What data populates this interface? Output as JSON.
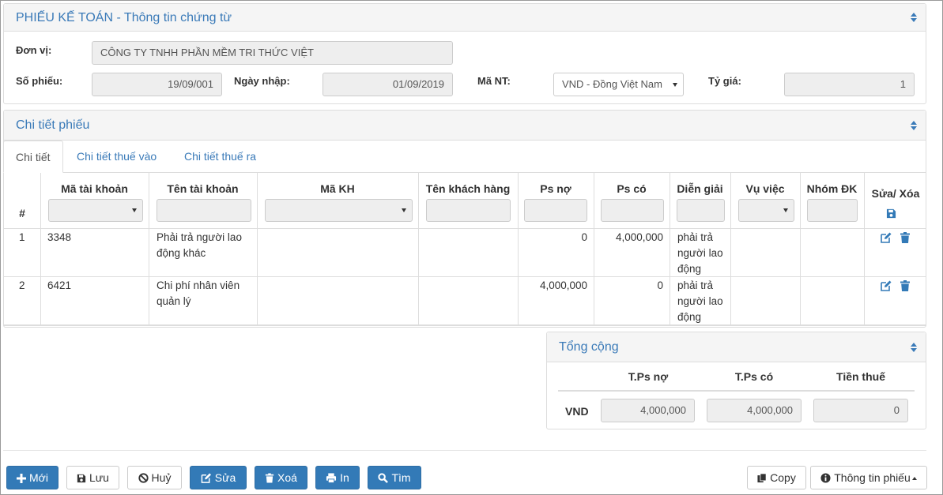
{
  "voucher_panel": {
    "title": "PHIẾU KẾ TOÁN - Thông tin chứng từ",
    "unit_label": "Đơn vị:",
    "unit_value": "CÔNG TY TNHH PHẦN MỀM TRI THỨC VIỆT",
    "voucher_no_label": "Số phiếu:",
    "voucher_no_value": "19/09/001",
    "entry_date_label": "Ngày nhập:",
    "entry_date_value": "01/09/2019",
    "currency_label": "Mã NT:",
    "currency_value": "VND - Đồng Việt Nam",
    "rate_label": "Tỷ giá:",
    "rate_value": "1"
  },
  "detail_panel": {
    "title": "Chi tiết phiếu",
    "tabs": [
      {
        "label": "Chi tiết",
        "active": true
      },
      {
        "label": "Chi tiết thuế vào",
        "active": false
      },
      {
        "label": "Chi tiết thuế ra",
        "active": false
      }
    ],
    "columns": [
      "#",
      "Mã tài khoản",
      "Tên tài khoản",
      "Mã KH",
      "Tên khách hàng",
      "Ps nợ",
      "Ps có",
      "Diễn giải",
      "Vụ việc",
      "Nhóm ĐK",
      "Sửa/ Xóa"
    ],
    "rows": [
      {
        "no": "1",
        "account_code": "3348",
        "account_name": "Phải trả người lao động khác",
        "customer_code": "",
        "customer_name": "",
        "debit": "0",
        "credit": "4,000,000",
        "description": "phải trả người lao động",
        "case": "",
        "group": ""
      },
      {
        "no": "2",
        "account_code": "6421",
        "account_name": "Chi phí nhân viên quản lý",
        "customer_code": "",
        "customer_name": "",
        "debit": "4,000,000",
        "credit": "0",
        "description": "phải trả người lao động",
        "case": "",
        "group": ""
      }
    ]
  },
  "totals_panel": {
    "title": "Tổng cộng",
    "col_debit": "T.Ps nợ",
    "col_credit": "T.Ps có",
    "col_tax": "Tiền thuế",
    "currency": "VND",
    "debit_total": "4,000,000",
    "credit_total": "4,000,000",
    "tax_total": "0"
  },
  "toolbar": {
    "new_label": "Mới",
    "save_label": "Lưu",
    "cancel_label": "Huỷ",
    "edit_label": "Sửa",
    "delete_label": "Xoá",
    "print_label": "In",
    "search_label": "Tìm",
    "copy_label": "Copy",
    "info_label": "Thông tin phiếu"
  },
  "colors": {
    "primary": "#337ab7",
    "title_blue": "#3a7ab8",
    "readonly_bg": "#eeeeee",
    "border": "#dddddd"
  }
}
